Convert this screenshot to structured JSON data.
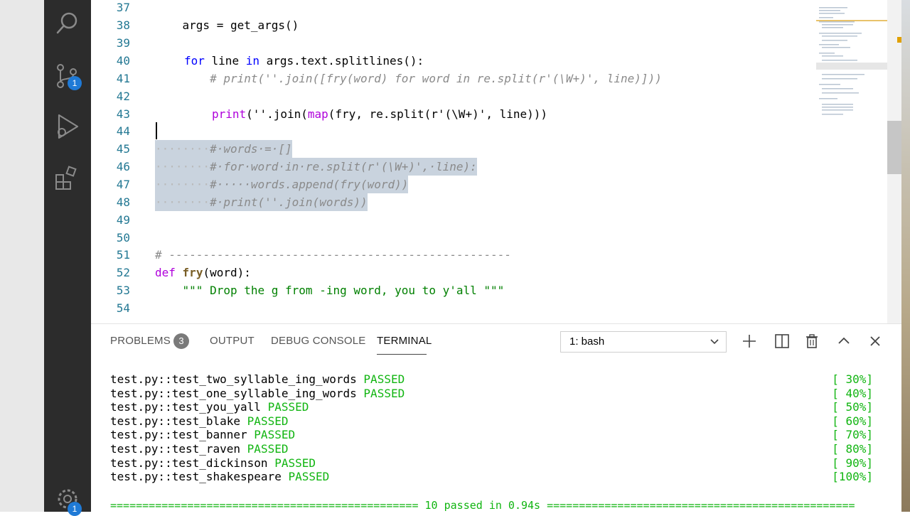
{
  "activity": {
    "scm_badge": "1",
    "settings_badge": "1"
  },
  "editor": {
    "lines": [
      {
        "n": "37",
        "text": ""
      },
      {
        "n": "38",
        "text": "    args = get_args()"
      },
      {
        "n": "39",
        "text": ""
      },
      {
        "n": "40",
        "kw": "for",
        "mid": " line ",
        "kw2": "in",
        "rest": " args.text.splitlines():"
      },
      {
        "n": "41",
        "comment": "        # print(''.join([fry(word) for word in re.split(r'(\\W+)', line)]))"
      },
      {
        "n": "42",
        "text": ""
      },
      {
        "n": "43",
        "fn1": "print",
        "p1": "(''.join(",
        "fn2": "map",
        "p2": "(fry, re.split(r'(\\W+)', line)))"
      },
      {
        "n": "44",
        "text": ""
      },
      {
        "n": "45",
        "ws": "········",
        "sel_comment": "#·words·=·[]"
      },
      {
        "n": "46",
        "ws": "········",
        "sel_comment": "#·for·word·in·re.split(r'(\\W+)',·line):"
      },
      {
        "n": "47",
        "ws": "········",
        "sel_comment": "#·····words.append(fry(word))"
      },
      {
        "n": "48",
        "ws": "········",
        "sel_comment": "#·print(''.join(words))"
      },
      {
        "n": "49",
        "text": ""
      },
      {
        "n": "50",
        "text": ""
      },
      {
        "n": "51",
        "comment": "# --------------------------------------------------"
      },
      {
        "n": "52",
        "kw": "def",
        "fname": "fry",
        "rest": "(word):"
      },
      {
        "n": "53",
        "doc": "    \"\"\" Drop the g from -ing word, you to y'all \"\"\""
      },
      {
        "n": "54",
        "text": ""
      }
    ]
  },
  "panel": {
    "tabs": {
      "problems": "PROBLEMS",
      "problems_count": "3",
      "output": "OUTPUT",
      "debug": "DEBUG CONSOLE",
      "terminal": "TERMINAL"
    },
    "terminal_select": "1: bash",
    "results": [
      {
        "name": "test.py::test_two_syllable_ing_words",
        "status": "PASSED",
        "pct": "[ 30%]"
      },
      {
        "name": "test.py::test_one_syllable_ing_words",
        "status": "PASSED",
        "pct": "[ 40%]"
      },
      {
        "name": "test.py::test_you_yall",
        "status": "PASSED",
        "pct": "[ 50%]"
      },
      {
        "name": "test.py::test_blake",
        "status": "PASSED",
        "pct": "[ 60%]"
      },
      {
        "name": "test.py::test_banner",
        "status": "PASSED",
        "pct": "[ 70%]"
      },
      {
        "name": "test.py::test_raven",
        "status": "PASSED",
        "pct": "[ 80%]"
      },
      {
        "name": "test.py::test_dickinson",
        "status": "PASSED",
        "pct": "[ 90%]"
      },
      {
        "name": "test.py::test_shakespeare",
        "status": "PASSED",
        "pct": "[100%]"
      }
    ],
    "summary": "================================================ 10 passed in 0.94s ================================================"
  }
}
